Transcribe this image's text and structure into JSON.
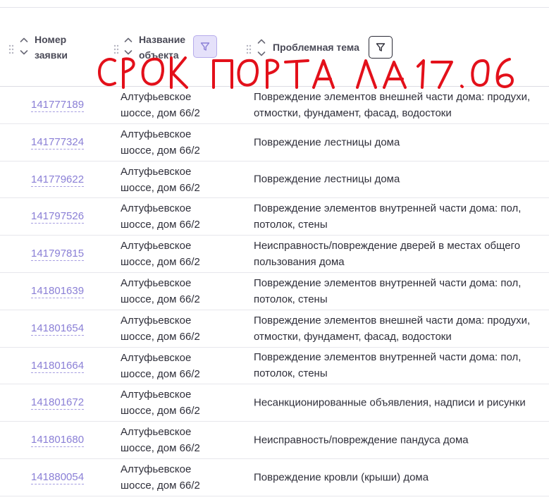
{
  "table": {
    "columns": {
      "number": {
        "line1": "Номер",
        "line2": "заявки"
      },
      "object": {
        "line1": "Название",
        "line2": "объекта"
      },
      "theme": {
        "label": "Проблемная тема"
      }
    },
    "rows": [
      {
        "number": "141777189",
        "object_line1": "Алтуфьевское",
        "object_line2": "шоссе, дом 66/2",
        "theme": "Повреждение элементов внешней части дома: продухи, отмостки, фундамент, фасад, водостоки"
      },
      {
        "number": "141777324",
        "object_line1": "Алтуфьевское",
        "object_line2": "шоссе, дом 66/2",
        "theme": "Повреждение лестницы дома"
      },
      {
        "number": "141779622",
        "object_line1": "Алтуфьевское",
        "object_line2": "шоссе, дом 66/2",
        "theme": "Повреждение лестницы дома"
      },
      {
        "number": "141797526",
        "object_line1": "Алтуфьевское",
        "object_line2": "шоссе, дом 66/2",
        "theme": "Повреждение элементов внутренней части дома: пол, потолок, стены"
      },
      {
        "number": "141797815",
        "object_line1": "Алтуфьевское",
        "object_line2": "шоссе, дом 66/2",
        "theme": "Неисправность/повреждение дверей в местах общего пользования дома"
      },
      {
        "number": "141801639",
        "object_line1": "Алтуфьевское",
        "object_line2": "шоссе, дом 66/2",
        "theme": "Повреждение элементов внутренней части дома: пол, потолок, стены"
      },
      {
        "number": "141801654",
        "object_line1": "Алтуфьевское",
        "object_line2": "шоссе, дом 66/2",
        "theme": "Повреждение элементов внешней части дома: продухи, отмостки, фундамент, фасад, водостоки"
      },
      {
        "number": "141801664",
        "object_line1": "Алтуфьевское",
        "object_line2": "шоссе, дом 66/2",
        "theme": "Повреждение элементов внутренней части дома: пол, потолок, стены"
      },
      {
        "number": "141801672",
        "object_line1": "Алтуфьевское",
        "object_line2": "шоссе, дом 66/2",
        "theme": "Несанкционированные объявления, надписи и рисунки"
      },
      {
        "number": "141801680",
        "object_line1": "Алтуфьевское",
        "object_line2": "шоссе, дом 66/2",
        "theme": "Неисправность/повреждение пандуса дома"
      },
      {
        "number": "141880054",
        "object_line1": "Алтуфьевское",
        "object_line2": "шоссе, дом 66/2",
        "theme": "Повреждение кровли (крыши) дома"
      }
    ]
  },
  "annotation": {
    "text": "СРОК ПОРТА ЛА17.06",
    "color": "#e3101a"
  },
  "colors": {
    "link": "#8a7fd6",
    "filter_active_bg": "#e5e1fa",
    "filter_active_border": "#b6aceb",
    "text": "#2f2f3a"
  },
  "icons": {
    "drag": "drag-dots-icon",
    "sort": "sort-chevrons-icon",
    "filter": "funnel-icon"
  }
}
